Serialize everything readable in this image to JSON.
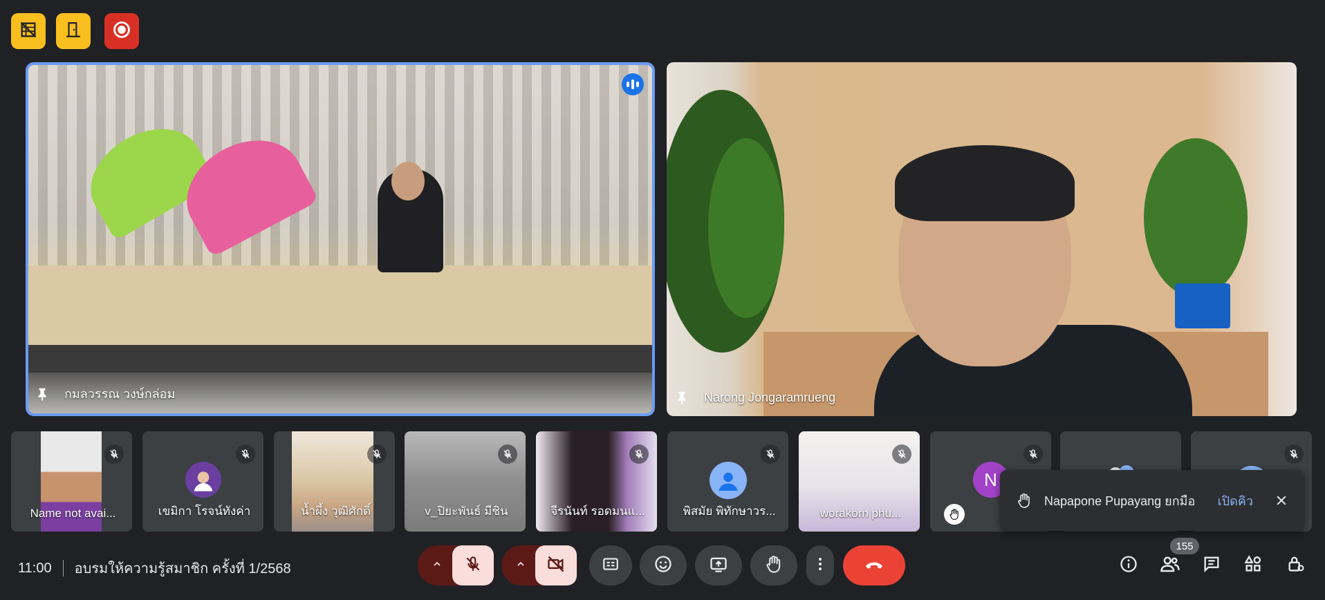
{
  "top_buttons": [
    {
      "icon": "video-off-grid-icon",
      "color": "#f9bf1e"
    },
    {
      "icon": "door-exit-icon",
      "color": "#f9bf1e"
    },
    {
      "icon": "record-icon",
      "color": "#d93025"
    }
  ],
  "main_tiles": [
    {
      "name": "กมลวรรณ วงษ์กล่อม",
      "speaking": true,
      "icon": "pin-icon"
    },
    {
      "name": "Narong Jongaramrueng",
      "speaking": false,
      "icon": "pin-icon"
    }
  ],
  "thumbnails": [
    {
      "name": "Name not avai...",
      "muted": true
    },
    {
      "name": "เขมิกา โรจน์ทังค่า",
      "muted": true
    },
    {
      "name": "น้ำผึ้ง วุฒิศักดิ์",
      "muted": true
    },
    {
      "name": "v_ปิยะพันธ์ มีชิน",
      "muted": true
    },
    {
      "name": "จีรนันท์ รอดมนแ...",
      "muted": true
    },
    {
      "name": "พิสมัย พิทักษาวร...",
      "muted": true
    },
    {
      "name": "worakorn phu...",
      "muted": true
    },
    {
      "name": "",
      "initial": "N",
      "muted": true
    },
    {
      "name": "",
      "muted": false
    },
    {
      "name": "",
      "muted": true
    }
  ],
  "toast": {
    "message": "Napapone Pupayang ยกมือ",
    "action": "เปิดคิว",
    "icon": "raised-hand-icon"
  },
  "meeting": {
    "time": "11:00",
    "title": "อบรมให้ความรู้สมาชิก ครั้งที่ 1/2568"
  },
  "controls": [
    "microphone-options-chevron",
    "microphone-muted",
    "camera-options-chevron",
    "camera-off",
    "captions",
    "emoji-reactions",
    "present-screen",
    "raise-hand",
    "more-options",
    "leave-call"
  ],
  "right_controls": {
    "participants_count": "155",
    "icons": [
      "info-icon",
      "people-icon",
      "chat-icon",
      "activities-icon",
      "host-controls-icon"
    ]
  },
  "colors": {
    "background": "#202124",
    "active_border": "#6b9bf5",
    "end_call": "#ea4335",
    "muted_control": "#f9dedc",
    "accent_blue": "#8ab4f8"
  }
}
